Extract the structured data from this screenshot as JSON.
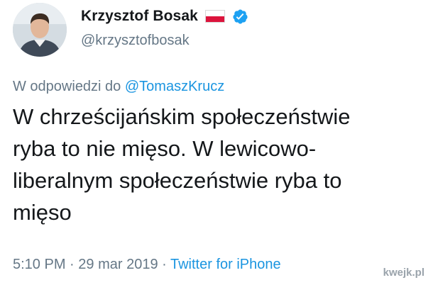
{
  "author": {
    "display_name": "Krzysztof Bosak",
    "handle": "@krzysztofbosak",
    "flag": "flag-poland-icon",
    "verified_icon": "verified-badge-icon"
  },
  "reply": {
    "prefix": "W odpowiedzi do ",
    "to_handle": "@TomaszKrucz"
  },
  "tweet": {
    "lines": [
      "W chrześcijańskim społeczeństwie",
      "ryba to nie mięso. W lewicowo-",
      "liberalnym społeczeństwie ryba to",
      "mięso"
    ]
  },
  "meta": {
    "time": "5:10 PM",
    "separator": " · ",
    "date": "29 mar 2019",
    "source": "Twitter for iPhone"
  },
  "watermark": {
    "text": "kwejk.pl"
  },
  "colors": {
    "accent": "#1b95e0",
    "text": "#14171a",
    "muted": "#657786",
    "flag_red": "#dc143c"
  }
}
